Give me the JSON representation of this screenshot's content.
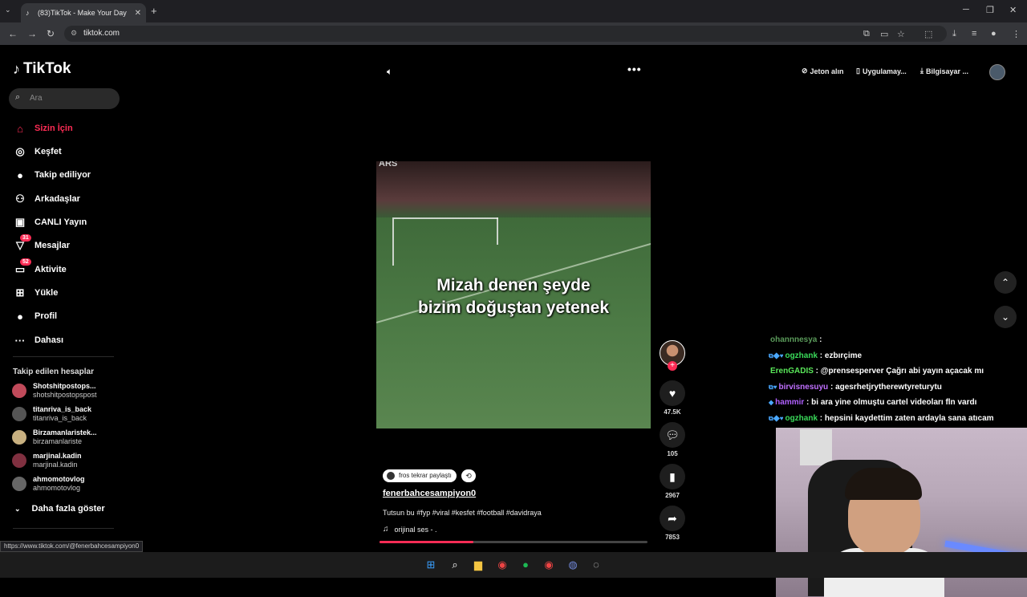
{
  "browser": {
    "tab_title": "(83)TikTok - Make Your Day",
    "url": "tiktok.com",
    "new_tab": "+",
    "tab_menu": "⌄"
  },
  "status_url": "https://www.tiktok.com/@fenerbahcesampiyon0",
  "tiktok": {
    "logo": "TikTok",
    "search_placeholder": "Ara",
    "nav": [
      {
        "label": "Sizin İçin",
        "icon": "home-icon",
        "glyph": "⌂"
      },
      {
        "label": "Keşfet",
        "icon": "compass-icon",
        "glyph": "◎"
      },
      {
        "label": "Takip ediliyor",
        "icon": "following-avatar-icon",
        "glyph": "●"
      },
      {
        "label": "Arkadaşlar",
        "icon": "friends-icon",
        "glyph": "⚇"
      },
      {
        "label": "CANLI Yayın",
        "icon": "live-icon",
        "glyph": "▣"
      },
      {
        "label": "Mesajlar",
        "icon": "messages-icon",
        "glyph": "▽",
        "badge": "31"
      },
      {
        "label": "Aktivite",
        "icon": "activity-icon",
        "glyph": "▭",
        "badge": "52"
      },
      {
        "label": "Yükle",
        "icon": "upload-icon",
        "glyph": "⊞"
      },
      {
        "label": "Profil",
        "icon": "profile-avatar-icon",
        "glyph": "●"
      },
      {
        "label": "Dahası",
        "icon": "more-icon",
        "glyph": "···"
      }
    ],
    "following_title": "Takip edilen hesaplar",
    "following": [
      {
        "name": "Shotshitpostops...",
        "handle": "shotshitpostopspost"
      },
      {
        "name": "titanriva_is_back",
        "handle": "titanriva_is_back"
      },
      {
        "name": "Birzamanlaristek...",
        "handle": "birzamanlariste"
      },
      {
        "name": "marjinal.kadin",
        "handle": "marjinal.kadin"
      },
      {
        "name": "ahmomotovlog",
        "handle": "ahmomotovlog"
      }
    ],
    "show_more": "Daha fazla göster",
    "top_links": {
      "coins": "Jeton alın",
      "app": "Uygulamay...",
      "desktop": "Bilgisayar ..."
    }
  },
  "video": {
    "scoreboard": "ARS",
    "overlay_line1": "Mizah denen şeyde",
    "overlay_line2": "bizim doğuştan yetenek",
    "progress": 0.35,
    "repost_label": "fros tekrar paylaştı",
    "author": "fenerbahcesampiyon0",
    "description": "Tutsun bu #fyp #viral #kesfet #football #davidraya",
    "music": "orijinal ses - .",
    "likes": "47.5K",
    "comments": "105",
    "saves": "2967",
    "shares": "7853"
  },
  "chat": [
    {
      "user": "ohannnesya",
      "msg": "",
      "color": "#5a9a5a",
      "icons": ""
    },
    {
      "user": "ogzhank",
      "msg": "ezbırçime",
      "color": "#3adb5a",
      "icons": "⧉◆♥"
    },
    {
      "user": "ErenGADIS",
      "msg": "@prensesperver Çağrı abi yayın açacak mı",
      "color": "#5ae85a",
      "icons": ""
    },
    {
      "user": "birvisnesuyu",
      "msg": "agesrhetjrytherewtyreturytu",
      "color": "#c070ff",
      "icons": "⧉♥"
    },
    {
      "user": "hammir",
      "msg": "bi ara yine olmuştu cartel videoları fln vardı",
      "color": "#b060ff",
      "icons": "◆"
    },
    {
      "user": "ogzhank",
      "msg": "hepsini kaydettim zaten ardayla sana atıcam",
      "color": "#3adb5a",
      "icons": "⧉◆♥"
    }
  ],
  "colors": {
    "accent": "#fe2c55",
    "bg": "#000000"
  }
}
